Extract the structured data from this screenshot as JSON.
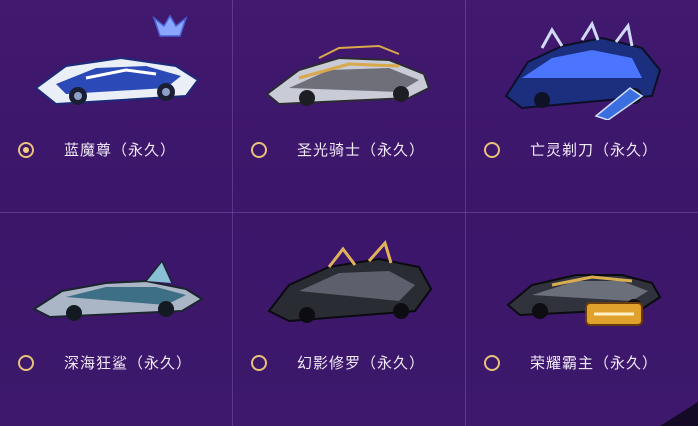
{
  "options": [
    {
      "label": "蓝魔尊（永久）",
      "selected": true,
      "car_icon": "blue-demon-car-icon",
      "badge": "blue-crown-icon"
    },
    {
      "label": "圣光骑士（永久）",
      "selected": false,
      "car_icon": "holy-knight-car-icon",
      "badge": ""
    },
    {
      "label": "亡灵剃刀（永久）",
      "selected": false,
      "car_icon": "undead-razor-car-icon",
      "badge": "xcar-badge-icon"
    },
    {
      "label": "深海狂鲨（永久）",
      "selected": false,
      "car_icon": "deep-sea-shark-car-icon",
      "badge": ""
    },
    {
      "label": "幻影修罗（永久）",
      "selected": false,
      "car_icon": "phantom-asura-car-icon",
      "badge": ""
    },
    {
      "label": "荣耀霸主（永久）",
      "selected": false,
      "car_icon": "glory-overlord-car-icon",
      "badge": "racing-champion-icon"
    }
  ],
  "colors": {
    "background": "#3b1669",
    "radio": "#e9c27a",
    "text": "#f0eaf7"
  }
}
